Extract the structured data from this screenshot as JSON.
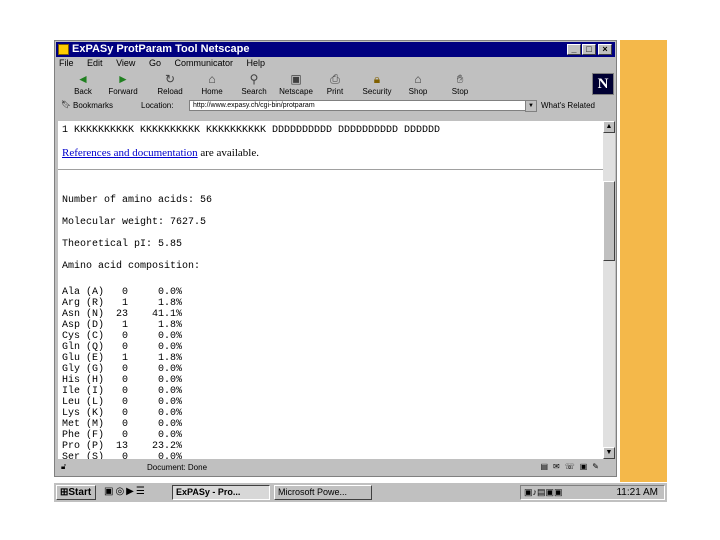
{
  "window": {
    "title": "Ex PASy - ProtParam Tool - Netscape",
    "title_display": "ExPASy ProtParam Tool Netscape"
  },
  "menu": [
    "File",
    "Edit",
    "View",
    "Go",
    "Communicator",
    "Help"
  ],
  "toolbar": [
    {
      "label": "Back",
      "icon": "back-arrow-icon"
    },
    {
      "label": "Forward",
      "icon": "forward-arrow-icon"
    },
    {
      "label": "Reload",
      "icon": "reload-icon"
    },
    {
      "label": "Home",
      "icon": "home-icon"
    },
    {
      "label": "Search",
      "icon": "search-icon"
    },
    {
      "label": "Netscape",
      "icon": "netscape-icon"
    },
    {
      "label": "Print",
      "icon": "print-icon"
    },
    {
      "label": "Security",
      "icon": "security-icon"
    },
    {
      "label": "Shop",
      "icon": "shop-icon"
    },
    {
      "label": "Stop",
      "icon": "stop-icon"
    }
  ],
  "location": {
    "bookmarks_label": "Bookmarks",
    "location_label": "Location:",
    "url": "http://www.expasy.ch/cgi-bin/protparam",
    "whats_related": "What's Related"
  },
  "content": {
    "sequence_line": "1 KKKKKKKKKK KKKKKKKKKK KKKKKKKKKK DDDDDDDDDD DDDDDDDDDD DDDDDD",
    "refs_link": "References and documentation",
    "refs_tail": " are available.",
    "num_aa": "Number of amino acids: 56",
    "mol_weight": "Molecular weight: 7627.5",
    "pi": "Theoretical pI: 5.85",
    "composition_title": "Amino acid composition:",
    "composition": [
      "Ala (A)   0     0.0%",
      "Arg (R)   1     1.8%",
      "Asn (N)  23    41.1%",
      "Asp (D)   1     1.8%",
      "Cys (C)   0     0.0%",
      "Gln (Q)   0     0.0%",
      "Glu (E)   1     1.8%",
      "Gly (G)   0     0.0%",
      "His (H)   0     0.0%",
      "Ile (I)   0     0.0%",
      "Leu (L)   0     0.0%",
      "Lys (K)   0     0.0%",
      "Met (M)   0     0.0%",
      "Phe (F)   0     0.0%",
      "Pro (P)  13    23.2%",
      "Ser (S)   0     0.0%"
    ]
  },
  "status": {
    "text": "Document: Done"
  },
  "taskbar": {
    "start": "Start",
    "tasks": [
      "ExPASy - Pro...",
      "Microsoft Powe..."
    ],
    "clock": "11:21 AM"
  },
  "colors": {
    "accent_sidebar": "#f4b84a",
    "titlebar": "#000080",
    "link": "#0000cc"
  }
}
